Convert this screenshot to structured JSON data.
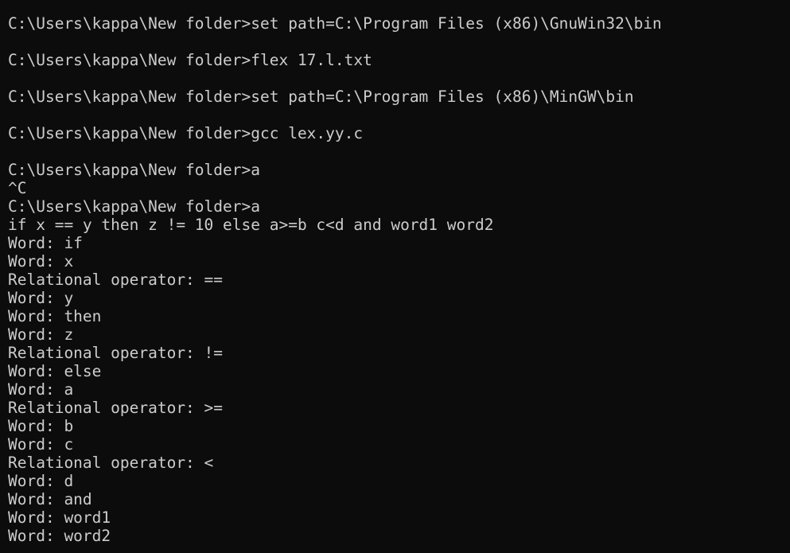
{
  "terminal": {
    "lines": [
      "C:\\Users\\kappa\\New folder>set path=C:\\Program Files (x86)\\GnuWin32\\bin",
      "",
      "C:\\Users\\kappa\\New folder>flex 17.l.txt",
      "",
      "C:\\Users\\kappa\\New folder>set path=C:\\Program Files (x86)\\MinGW\\bin",
      "",
      "C:\\Users\\kappa\\New folder>gcc lex.yy.c",
      "",
      "C:\\Users\\kappa\\New folder>a",
      "^C",
      "C:\\Users\\kappa\\New folder>a",
      "if x == y then z != 10 else a>=b c<d and word1 word2",
      "Word: if",
      "Word: x",
      "Relational operator: ==",
      "Word: y",
      "Word: then",
      "Word: z",
      "Relational operator: !=",
      "Word: else",
      "Word: a",
      "Relational operator: >=",
      "Word: b",
      "Word: c",
      "Relational operator: <",
      "Word: d",
      "Word: and",
      "Word: word1",
      "Word: word2"
    ],
    "colors": {
      "background": "#0c0c0c",
      "foreground": "#cccccc"
    }
  }
}
